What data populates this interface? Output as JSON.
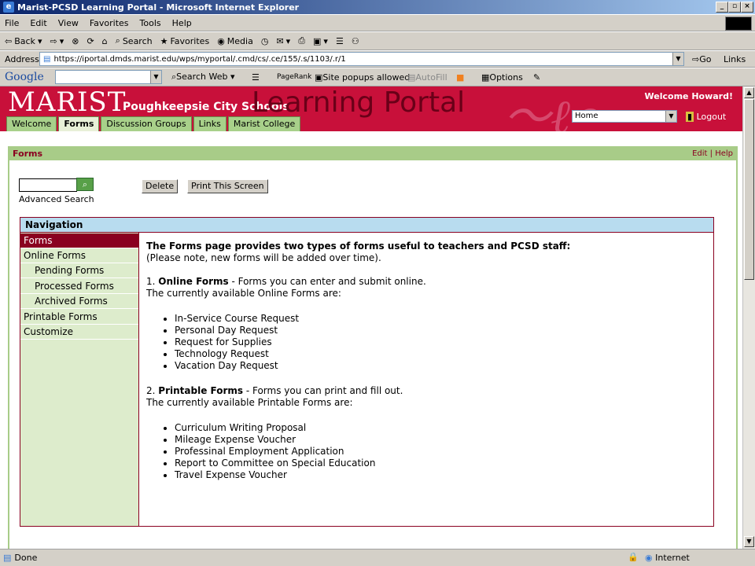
{
  "window": {
    "title": "Marist-PCSD Learning Portal - Microsoft Internet Explorer"
  },
  "menu": [
    "File",
    "Edit",
    "View",
    "Favorites",
    "Tools",
    "Help"
  ],
  "toolbar": {
    "back": "Back",
    "search": "Search",
    "favorites": "Favorites",
    "media": "Media"
  },
  "address": {
    "label": "Address",
    "url": "https://iportal.dmds.marist.edu/wps/myportal/.cmd/cs/.ce/155/.s/1103/.r/1",
    "go": "Go",
    "links": "Links"
  },
  "googlebar": {
    "logo": "Google",
    "search_web": "Search Web",
    "pagerank": "PageRank",
    "popups": "Site popups allowed",
    "autofill": "AutoFill",
    "options": "Options"
  },
  "banner": {
    "marist": "MARIST",
    "pcsd": "Poughkeepsie City Schools",
    "portal": "Learning Portal",
    "welcome": "Welcome Howard!",
    "home_select": "Home",
    "logout": "Logout"
  },
  "tabs": [
    {
      "label": "Welcome",
      "active": false
    },
    {
      "label": "Forms",
      "active": true
    },
    {
      "label": "Discussion Groups",
      "active": false
    },
    {
      "label": "Links",
      "active": false
    },
    {
      "label": "Marist College",
      "active": false
    }
  ],
  "page": {
    "title": "Forms",
    "edit": "Edit",
    "help": "Help",
    "advanced_search": "Advanced Search",
    "delete": "Delete",
    "print": "Print This Screen"
  },
  "nav": {
    "heading": "Navigation",
    "items": [
      {
        "label": "Forms",
        "sub": false,
        "active": true
      },
      {
        "label": "Online Forms",
        "sub": false,
        "active": false
      },
      {
        "label": "Pending Forms",
        "sub": true,
        "active": false
      },
      {
        "label": "Processed Forms",
        "sub": true,
        "active": false
      },
      {
        "label": "Archived Forms",
        "sub": true,
        "active": false
      },
      {
        "label": "Printable Forms",
        "sub": false,
        "active": false
      },
      {
        "label": "Customize",
        "sub": false,
        "active": false
      }
    ]
  },
  "content": {
    "intro_bold": "The Forms page provides two types of forms useful to teachers and PCSD staff:",
    "intro_note": "(Please note, new forms will be added over time).",
    "online_num": "1.",
    "online_title": "Online Forms",
    "online_desc": " - Forms you can enter and submit online.",
    "online_avail": "The currently available Online Forms are:",
    "online_list": [
      "In-Service Course Request",
      "Personal Day Request",
      "Request for Supplies",
      "Technology Request",
      "Vacation Day Request"
    ],
    "print_num": "2.",
    "print_title": "Printable Forms",
    "print_desc": " - Forms you can print and fill out.",
    "print_avail": "The currently available Printable Forms are:",
    "print_list": [
      "Curriculum Writing Proposal",
      "Mileage Expense Voucher",
      "Professinal Employment Application",
      "Report to Committee on Special Education",
      "Travel Expense Voucher"
    ]
  },
  "status": {
    "done": "Done",
    "zone": "Internet"
  }
}
